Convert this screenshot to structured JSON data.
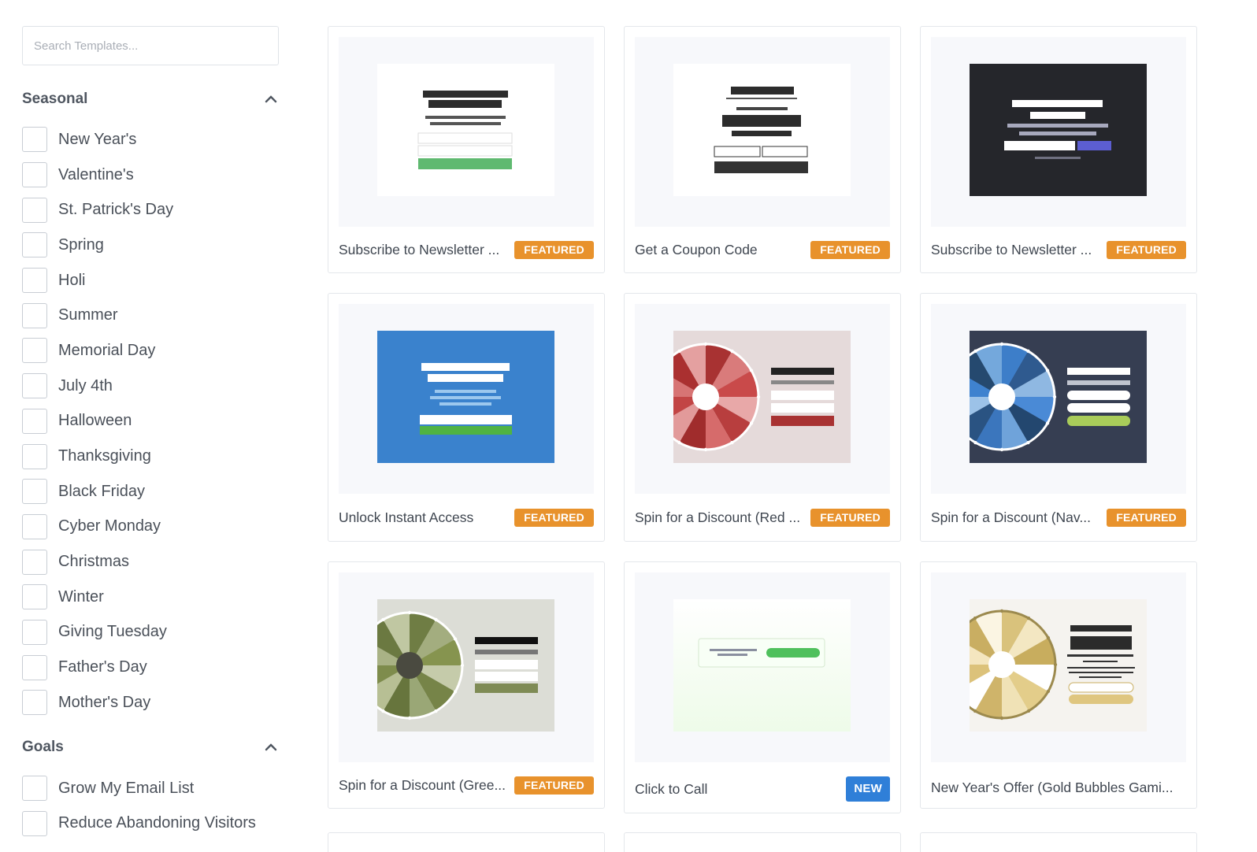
{
  "search": {
    "placeholder": "Search Templates..."
  },
  "seasonal": {
    "title": "Seasonal",
    "items": [
      "New Year's",
      "Valentine's",
      "St. Patrick's Day",
      "Spring",
      "Holi",
      "Summer",
      "Memorial Day",
      "July 4th",
      "Halloween",
      "Thanksgiving",
      "Black Friday",
      "Cyber Monday",
      "Christmas",
      "Winter",
      "Giving Tuesday",
      "Father's Day",
      "Mother's Day"
    ]
  },
  "goals": {
    "title": "Goals",
    "items": [
      "Grow My Email List",
      "Reduce Abandoning Visitors"
    ]
  },
  "templates": [
    {
      "title": "Subscribe to Newsletter ...",
      "badge": "FEATURED"
    },
    {
      "title": "Get a Coupon Code",
      "badge": "FEATURED"
    },
    {
      "title": "Subscribe to Newsletter ...",
      "badge": "FEATURED"
    },
    {
      "title": "Unlock Instant Access",
      "badge": "FEATURED"
    },
    {
      "title": "Spin for a Discount (Red ...",
      "badge": "FEATURED"
    },
    {
      "title": "Spin for a Discount (Nav...",
      "badge": "FEATURED"
    },
    {
      "title": "Spin for a Discount (Gree...",
      "badge": "FEATURED"
    },
    {
      "title": "Click to Call",
      "badge": "NEW"
    },
    {
      "title": "New Year's Offer (Gold Bubbles Gami...",
      "badge": ""
    }
  ],
  "colors": {
    "featured": "#e8922c",
    "new": "#2f7fd8",
    "dark_preview": "#25262b",
    "blue_preview": "#3a82cd",
    "red_preview": "#e5dada",
    "navy_preview": "#363e52",
    "green_preview": "#dcddd6",
    "gold_preview": "#f5f3ef"
  }
}
